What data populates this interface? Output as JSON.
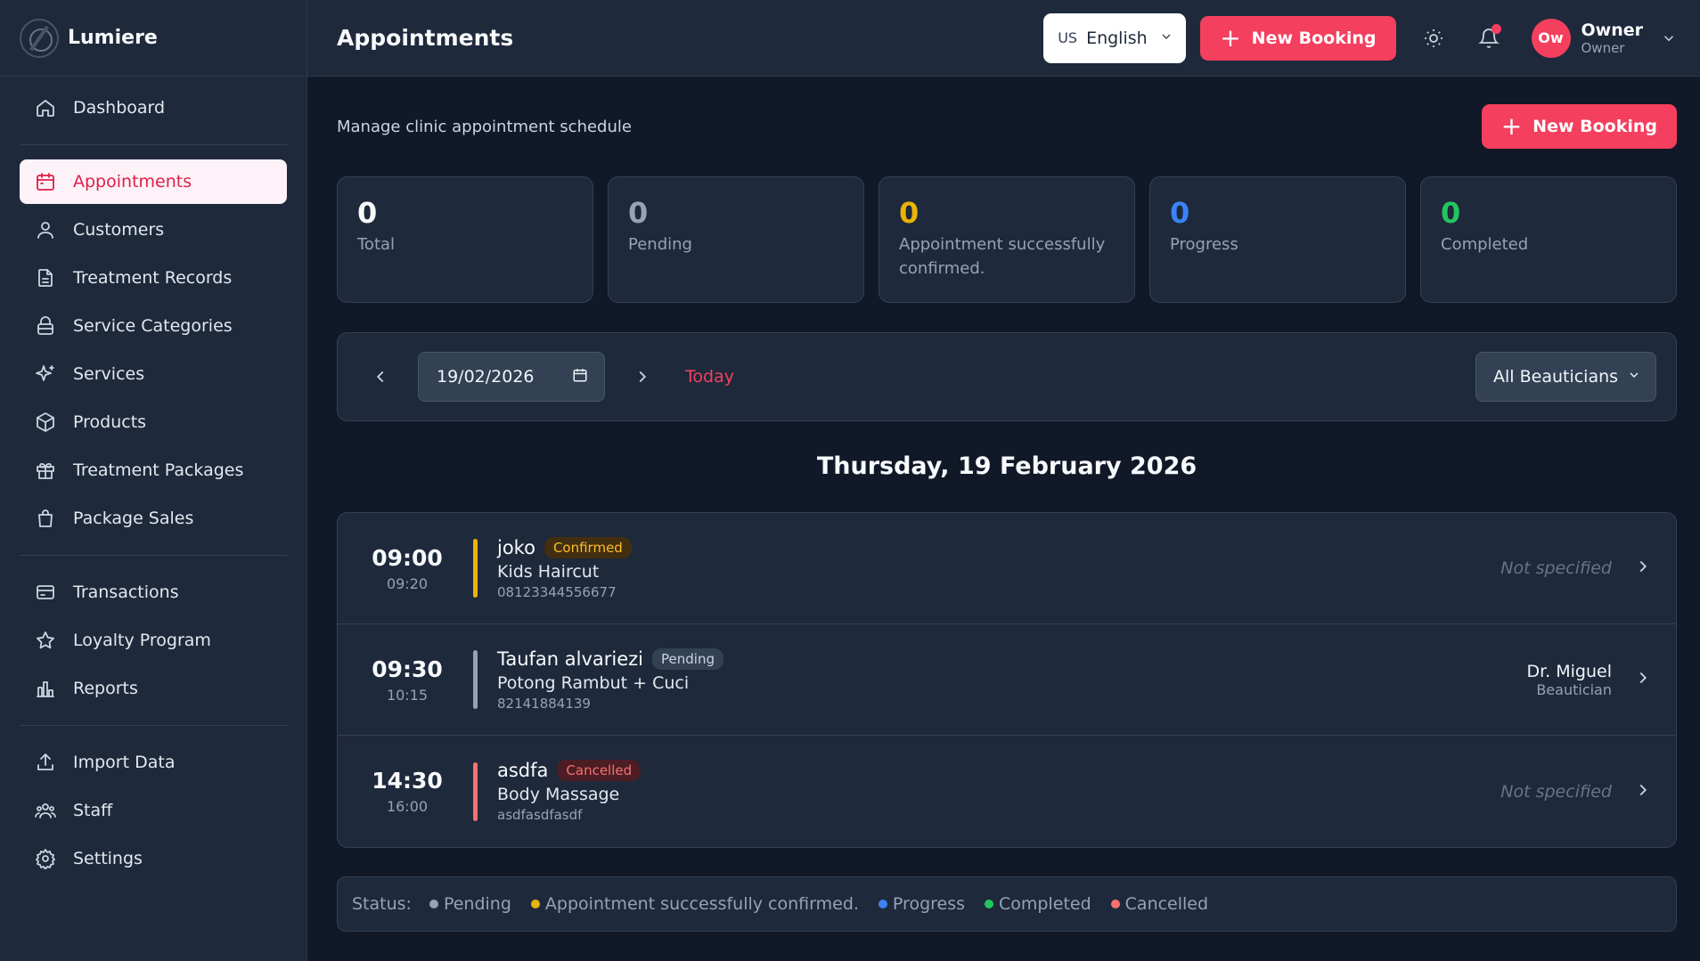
{
  "brand": {
    "name": "Lumiere"
  },
  "sidebar": {
    "groups": [
      [
        {
          "label": "Dashboard",
          "icon": "home-icon"
        }
      ],
      [
        {
          "label": "Appointments",
          "icon": "calendar-icon",
          "active": true
        },
        {
          "label": "Customers",
          "icon": "users-icon"
        },
        {
          "label": "Treatment Records",
          "icon": "file-icon"
        },
        {
          "label": "Service Categories",
          "icon": "layers-icon"
        },
        {
          "label": "Services",
          "icon": "sparkles-icon"
        },
        {
          "label": "Products",
          "icon": "box-icon"
        },
        {
          "label": "Treatment Packages",
          "icon": "gift-icon"
        },
        {
          "label": "Package Sales",
          "icon": "shopping-bag-icon"
        }
      ],
      [
        {
          "label": "Transactions",
          "icon": "credit-card-icon"
        },
        {
          "label": "Loyalty Program",
          "icon": "star-icon"
        },
        {
          "label": "Reports",
          "icon": "bar-chart-icon"
        }
      ],
      [
        {
          "label": "Import Data",
          "icon": "upload-icon"
        },
        {
          "label": "Staff",
          "icon": "team-icon"
        },
        {
          "label": "Settings",
          "icon": "gear-icon"
        }
      ]
    ]
  },
  "header": {
    "title": "Appointments",
    "language": {
      "flag": "US",
      "label": "English"
    },
    "new_booking_label": "New Booking",
    "user": {
      "initials": "Ow",
      "name": "Owner",
      "role": "Owner"
    }
  },
  "page": {
    "subtitle": "Manage clinic appointment schedule",
    "new_booking_label": "New Booking"
  },
  "stats": [
    {
      "value": "0",
      "label": "Total",
      "color": "#f8fafc"
    },
    {
      "value": "0",
      "label": "Pending",
      "color": "#94a3b8"
    },
    {
      "value": "0",
      "label": "Appointment successfully confirmed.",
      "color": "#eab308"
    },
    {
      "value": "0",
      "label": "Progress",
      "color": "#3b82f6"
    },
    {
      "value": "0",
      "label": "Completed",
      "color": "#22c55e"
    }
  ],
  "filters": {
    "date": "19/02/2026",
    "today_label": "Today",
    "beautician": "All Beauticians"
  },
  "day_title": "Thursday, 19 February 2026",
  "appointments": [
    {
      "start": "09:00",
      "end": "09:20",
      "customer": "joko",
      "status": "Confirmed",
      "status_color": "#eab308",
      "status_bg": "#422e10",
      "status_fg": "#fbbf24",
      "service": "Kids Haircut",
      "phone": "08123344556677",
      "staff": "Not specified",
      "staff_role": ""
    },
    {
      "start": "09:30",
      "end": "10:15",
      "customer": "Taufan alvariezi",
      "status": "Pending",
      "status_color": "#94a3b8",
      "status_bg": "#334155",
      "status_fg": "#cbd5e1",
      "service": "Potong Rambut + Cuci",
      "phone": "82141884139",
      "staff": "Dr. Miguel",
      "staff_role": "Beautician"
    },
    {
      "start": "14:30",
      "end": "16:00",
      "customer": "asdfa",
      "status": "Cancelled",
      "status_color": "#f87171",
      "status_bg": "#4c1d24",
      "status_fg": "#f87171",
      "service": "Body Massage",
      "phone": "asdfasdfasdf",
      "staff": "Not specified",
      "staff_role": ""
    }
  ],
  "legend": {
    "label": "Status:",
    "items": [
      {
        "label": "Pending",
        "color": "#94a3b8"
      },
      {
        "label": "Appointment successfully confirmed.",
        "color": "#eab308"
      },
      {
        "label": "Progress",
        "color": "#3b82f6"
      },
      {
        "label": "Completed",
        "color": "#22c55e"
      },
      {
        "label": "Cancelled",
        "color": "#f87171"
      }
    ]
  }
}
